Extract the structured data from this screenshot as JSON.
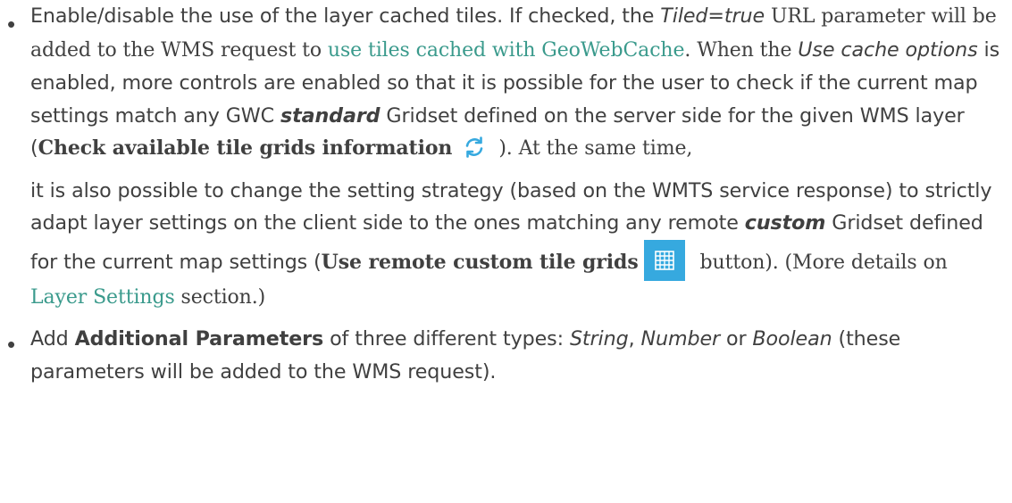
{
  "items": [
    {
      "p1": "Enable/disable the use of the layer cached tiles. If checked, the ",
      "tiled_param": "Tiled=true",
      "p2": " URL parameter will be added to the WMS request to ",
      "link1": "use tiles cached with GeoWebCache",
      "p3": ". When the ",
      "use_cache": "Use cache options",
      "p4": " is enabled, more controls are enabled so that it is possible for the user to check if the current map settings match any GWC ",
      "standard": "standard",
      "p5": " Gridset defined on the server side for the given WMS layer (",
      "check_label": "Check available tile grids information",
      "p6": "). At the same time,",
      "p7": "it is also possible to change the setting strategy (based on the WMTS service response) to strictly adapt layer settings on the client side to the ones matching any remote ",
      "custom": "custom",
      "p8": " Gridset defined for the current map settings (",
      "use_remote_label": "Use remote custom tile grids",
      "p9": " button). (More details on ",
      "link2": "Layer Settings",
      "p10": " section.)"
    },
    {
      "p1": "Add ",
      "strong": "Additional Parameters",
      "p2": " of three different types: ",
      "type1": "String",
      "sep1": ", ",
      "type2": "Number",
      "sep2": " or ",
      "type3": "Boolean",
      "p3": " (these parameters will be added to the WMS request)."
    }
  ],
  "icons": {
    "refresh": "refresh-icon",
    "grid": "grid-icon"
  },
  "colors": {
    "text": "#404040",
    "link": "#3a9a8c",
    "icon_blue": "#36a9df"
  }
}
